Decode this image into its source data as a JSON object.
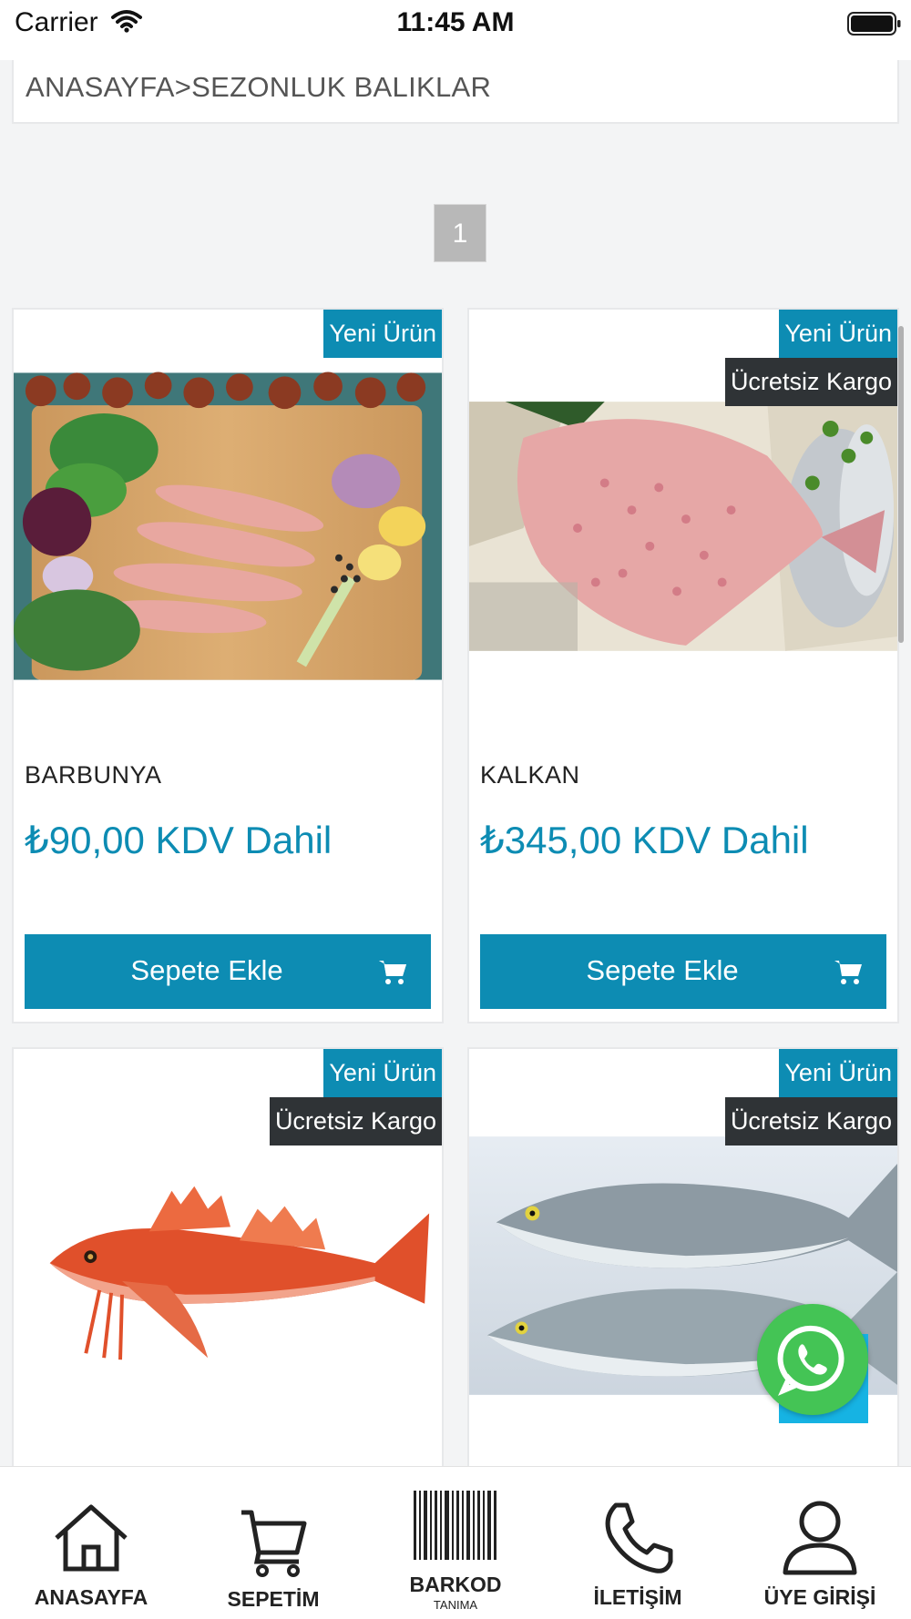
{
  "status": {
    "carrier": "Carrier",
    "time": "11:45 AM"
  },
  "breadcrumb": "ANASAYFA>SEZONLUK BALIKLAR",
  "pagination": {
    "current": "1"
  },
  "badges": {
    "new": "Yeni Ürün",
    "cargo": "Ücretsiz Kargo"
  },
  "products": [
    {
      "name": "BARBUNYA",
      "price": "₺90,00 KDV Dahil",
      "button": "Sepete Ekle"
    },
    {
      "name": "KALKAN",
      "price": "₺345,00 KDV Dahil",
      "button": "Sepete Ekle"
    }
  ],
  "tabs": [
    {
      "label": "ANASAYFA"
    },
    {
      "label": "SEPETİM"
    },
    {
      "label": "BARKOD",
      "sub": "TANIMA"
    },
    {
      "label": "İLETİŞİM"
    },
    {
      "label": "ÜYE GİRİŞİ"
    }
  ],
  "colors": {
    "accent": "#0d8cb3",
    "badge_dark": "#2f3336",
    "whatsapp": "#44c455"
  },
  "icons": [
    "wifi-icon",
    "battery-icon",
    "cart-icon",
    "whatsapp-icon",
    "home-icon",
    "basket-icon",
    "barcode-icon",
    "phone-icon",
    "user-icon"
  ]
}
